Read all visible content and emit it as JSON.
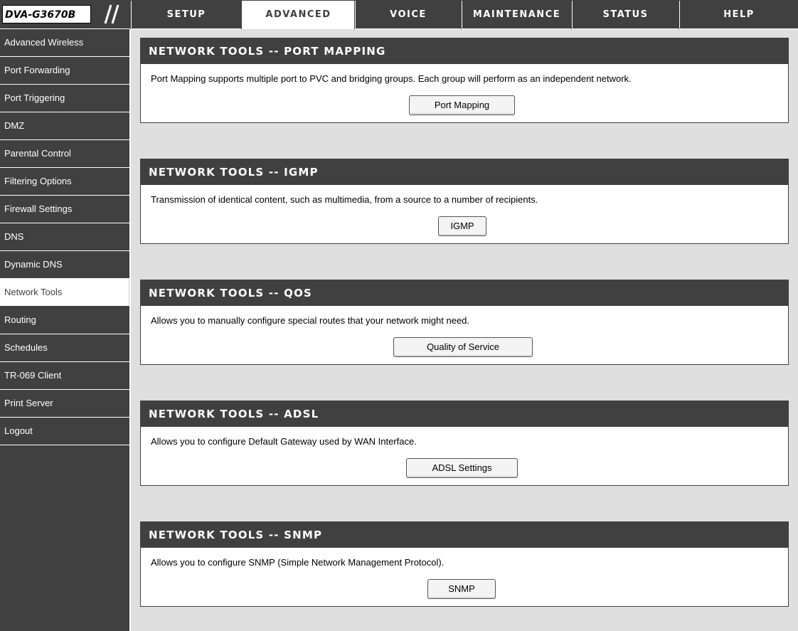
{
  "brand": {
    "model": "DVA-G3670B"
  },
  "tabs": [
    {
      "label": "SETUP"
    },
    {
      "label": "ADVANCED"
    },
    {
      "label": "VOICE"
    },
    {
      "label": "MAINTENANCE"
    },
    {
      "label": "STATUS"
    },
    {
      "label": "HELP"
    }
  ],
  "active_tab": "ADVANCED",
  "sidebar": {
    "items": [
      {
        "label": "Advanced Wireless"
      },
      {
        "label": "Port Forwarding"
      },
      {
        "label": "Port Triggering"
      },
      {
        "label": "DMZ"
      },
      {
        "label": "Parental Control"
      },
      {
        "label": "Filtering Options"
      },
      {
        "label": "Firewall Settings"
      },
      {
        "label": "DNS"
      },
      {
        "label": "Dynamic DNS"
      },
      {
        "label": "Network Tools"
      },
      {
        "label": "Routing"
      },
      {
        "label": "Schedules"
      },
      {
        "label": "TR-069 Client"
      },
      {
        "label": "Print Server"
      },
      {
        "label": "Logout"
      }
    ],
    "active": "Network Tools"
  },
  "sections": [
    {
      "title": "NETWORK TOOLS -- PORT MAPPING",
      "description": "Port Mapping supports multiple port to PVC and bridging groups. Each group will perform as an independent network.",
      "button": "Port Mapping"
    },
    {
      "title": "NETWORK TOOLS -- IGMP",
      "description": "Transmission of identical content, such as multimedia, from a source to a number of recipients.",
      "button": "IGMP"
    },
    {
      "title": "NETWORK TOOLS -- QOS",
      "description": "Allows you to manually configure special routes that your network might need.",
      "button": "Quality of Service"
    },
    {
      "title": "NETWORK TOOLS -- ADSL",
      "description": "Allows you to configure Default Gateway used by WAN Interface.",
      "button": "ADSL Settings"
    },
    {
      "title": "NETWORK TOOLS -- SNMP",
      "description": "Allows you to configure SNMP (Simple Network Management Protocol).",
      "button": "SNMP"
    }
  ],
  "colors": {
    "dark": "#404040",
    "panel_bg": "#dfdfdf",
    "white": "#ffffff"
  }
}
